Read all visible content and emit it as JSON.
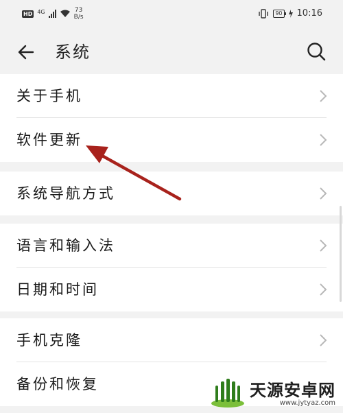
{
  "status_bar": {
    "left_badge": "HD",
    "network": "4G",
    "speed_value": "73",
    "speed_unit": "B/s",
    "battery": "90",
    "time": "10:16"
  },
  "header": {
    "title": "系统"
  },
  "groups": [
    {
      "items": [
        {
          "label": "关于手机"
        },
        {
          "label": "软件更新"
        }
      ]
    },
    {
      "items": [
        {
          "label": "系统导航方式"
        }
      ]
    },
    {
      "items": [
        {
          "label": "语言和输入法"
        },
        {
          "label": "日期和时间"
        }
      ]
    },
    {
      "items": [
        {
          "label": "手机克隆"
        },
        {
          "label": "备份和恢复"
        }
      ]
    }
  ],
  "annotation": {
    "arrow_color": "#a8221c",
    "target": "软件更新"
  },
  "watermark": {
    "text": "天源安卓网",
    "url": "www.jytyaz.com"
  }
}
